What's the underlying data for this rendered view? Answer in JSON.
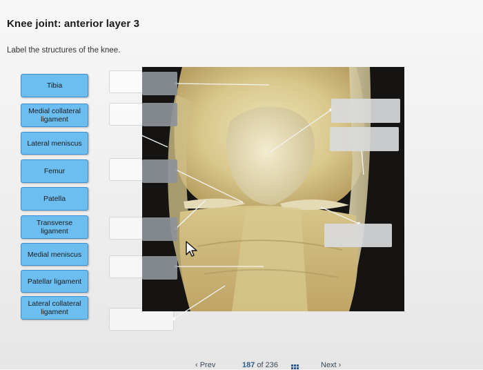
{
  "header": {
    "title": "Knee joint: anterior layer 3",
    "instruction": "Label the structures of the knee."
  },
  "labels": [
    "Tibia",
    "Medial collateral ligament",
    "Lateral meniscus",
    "Femur",
    "Patella",
    "Transverse ligament",
    "Medial meniscus",
    "Patellar ligament",
    "Lateral collateral ligament"
  ],
  "pager": {
    "prev_label": "‹ Prev",
    "current": "187",
    "of_label": "of",
    "total": "236",
    "next_label": "Next ›"
  },
  "colors": {
    "chip_fill": "#6cbdf0",
    "chip_border": "#3b8fd0",
    "target_dark": "#8d9399",
    "target_light": "#d9dadb"
  }
}
